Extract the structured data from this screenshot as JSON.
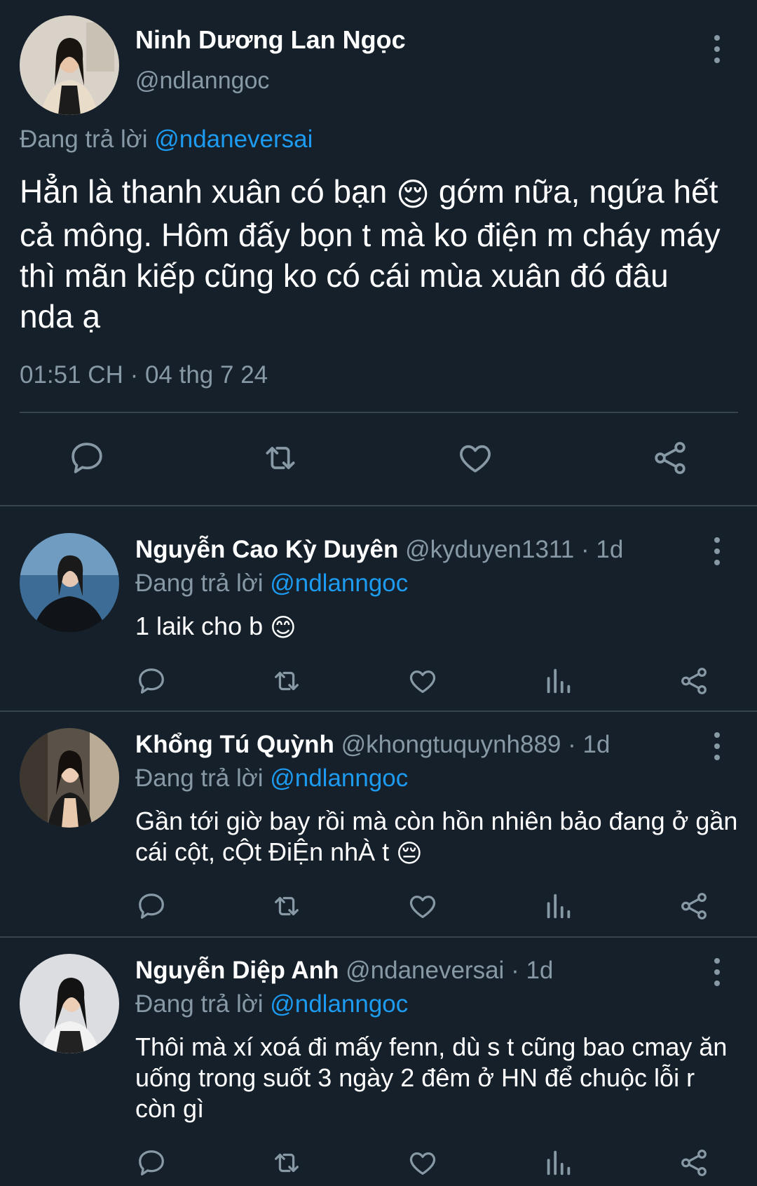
{
  "main_tweet": {
    "name": "Ninh Dương Lan Ngọc",
    "handle": "@ndlanngoc",
    "replying_prefix": "Đang trả lời",
    "replying_to": "@ndaneversai",
    "text_part1": "Hẳn là thanh xuân có bạn",
    "emoji": "😌",
    "text_part2": "gớm nữa, ngứa hết cả mông. Hôm đấy bọn t mà ko điện m cháy máy thì mãn kiếp cũng ko có cái mùa xuân đó đâu nda ạ",
    "timestamp": "01:51 CH · 04 thg 7 24",
    "avatar_icon": "avatar-photo",
    "actions": [
      "reply-icon",
      "retweet-icon",
      "like-icon",
      "share-icon"
    ]
  },
  "replies": [
    {
      "name": "Nguyễn Cao Kỳ Duyên",
      "handle": "@kyduyen1311",
      "time": "· 1d",
      "replying_prefix": "Đang trả lời",
      "replying_to": "@ndlanngoc",
      "text": "1 laik cho b",
      "emoji": "😊"
    },
    {
      "name": "Khổng Tú Quỳnh",
      "handle": "@khongtuquynh889",
      "time": "· 1d",
      "replying_prefix": "Đang trả lời",
      "replying_to": "@ndlanngoc",
      "text": "Gần tới giờ bay rồi mà còn hồn nhiên bảo đang ở gần cái cột, cỘt ĐiỆn nhÀ t",
      "emoji": "😔"
    },
    {
      "name": "Nguyễn Diệp Anh",
      "handle": "@ndaneversai",
      "time": "· 1d",
      "replying_prefix": "Đang trả lời",
      "replying_to": "@ndlanngoc",
      "text": "Thôi mà xí xoá đi mấy fenn, dù s t cũng bao cmay ăn uống trong suốt 3 ngày 2 đêm ở HN để chuộc lỗi r còn gì",
      "emoji": ""
    }
  ],
  "reply_actions": [
    "reply-icon",
    "retweet-icon",
    "like-icon",
    "analytics-icon",
    "share-icon"
  ],
  "colors": {
    "background": "#15202b",
    "muted": "#8899a6",
    "link": "#1d9bf0",
    "divider": "#38444d"
  }
}
